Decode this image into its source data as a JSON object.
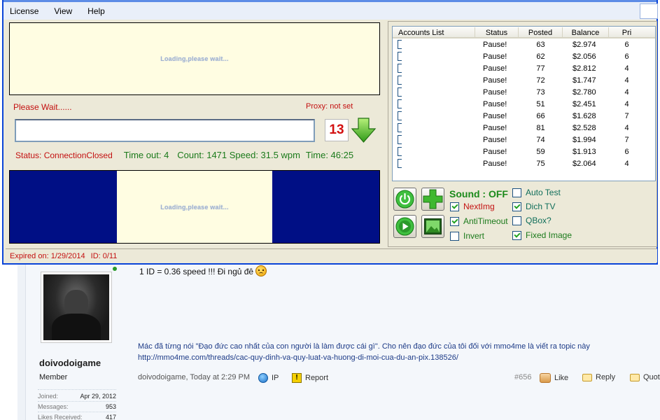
{
  "menu": {
    "license": "License",
    "view": "View",
    "help": "Help"
  },
  "captcha": {
    "loading_text": "Loading,please wait..."
  },
  "status": {
    "please_wait": "Please Wait......",
    "proxy": "Proxy: not set",
    "counter": "13",
    "connection": "Status: ConnectionClosed",
    "timeout": "Time out: 4",
    "count_speed": "Count: 1471 Speed: 31.5 wpm",
    "time": "Time: 46:25"
  },
  "ad": {
    "loading_text": "Loading,please wait..."
  },
  "statusbar": {
    "expired": "Expired on: 1/29/2014",
    "id": "ID: 0/11"
  },
  "accounts": {
    "headers": {
      "account": "Accounts List",
      "status": "Status",
      "posted": "Posted",
      "balance": "Balance",
      "pri": "Pri"
    },
    "rows": [
      {
        "status": "Pause!",
        "posted": "63",
        "balance": "$2.974",
        "pri": "6"
      },
      {
        "status": "Pause!",
        "posted": "62",
        "balance": "$2.056",
        "pri": "6"
      },
      {
        "status": "Pause!",
        "posted": "77",
        "balance": "$2.812",
        "pri": "4"
      },
      {
        "status": "Pause!",
        "posted": "72",
        "balance": "$1.747",
        "pri": "4"
      },
      {
        "status": "Pause!",
        "posted": "73",
        "balance": "$2.780",
        "pri": "4"
      },
      {
        "status": "Pause!",
        "posted": "51",
        "balance": "$2.451",
        "pri": "4"
      },
      {
        "status": "Pause!",
        "posted": "66",
        "balance": "$1.628",
        "pri": "7"
      },
      {
        "status": "Pause!",
        "posted": "81",
        "balance": "$2.528",
        "pri": "4"
      },
      {
        "status": "Pause!",
        "posted": "74",
        "balance": "$1.994",
        "pri": "7"
      },
      {
        "status": "Pause!",
        "posted": "59",
        "balance": "$1.913",
        "pri": "6"
      },
      {
        "status": "Pause!",
        "posted": "75",
        "balance": "$2.064",
        "pri": "4"
      }
    ]
  },
  "controls": {
    "sound": "Sound : OFF",
    "options": {
      "nextimg": {
        "label": "NextImg",
        "checked": true
      },
      "antitimeout": {
        "label": "AntiTimeout",
        "checked": true
      },
      "invert": {
        "label": "Invert",
        "checked": false
      },
      "autotest": {
        "label": "Auto Test",
        "checked": false
      },
      "dichtv": {
        "label": "Dich TV",
        "checked": true
      },
      "qbox": {
        "label": "QBox?",
        "checked": false
      },
      "fixedimage": {
        "label": "Fixed Image",
        "checked": true
      }
    }
  },
  "forum": {
    "username": "doivodoigame",
    "role": "Member",
    "stats": [
      {
        "label": "Joined:",
        "value": "Apr 29, 2012"
      },
      {
        "label": "Messages:",
        "value": "953"
      },
      {
        "label": "Likes Received:",
        "value": "417"
      }
    ],
    "message": "1 ID = 0.36 speed !!! Đi ngủ đê",
    "signature_line1": "Mác đã từng nói \"Đạo đức cao nhất của con người là làm được cái gì\". Cho nên đạo đức của tôi đối với mmo4me là viết ra topic này",
    "signature_line2": "http://mmo4me.com/threads/cac-quy-dinh-va-quy-luat-va-huong-di-moi-cua-du-an-pix.138526/",
    "footer_meta": "doivodoigame, Today at 2:29 PM",
    "ip": "IP",
    "report": "Report",
    "post_number": "#656",
    "like": "Like",
    "reply": "Reply",
    "quote": "Quote"
  },
  "colors": {
    "title_blue": "#0a44d8",
    "error_red": "#c31010",
    "ok_green": "#1b7a1b",
    "ad_navy": "#000f85",
    "captcha_bg": "#fffde2"
  }
}
